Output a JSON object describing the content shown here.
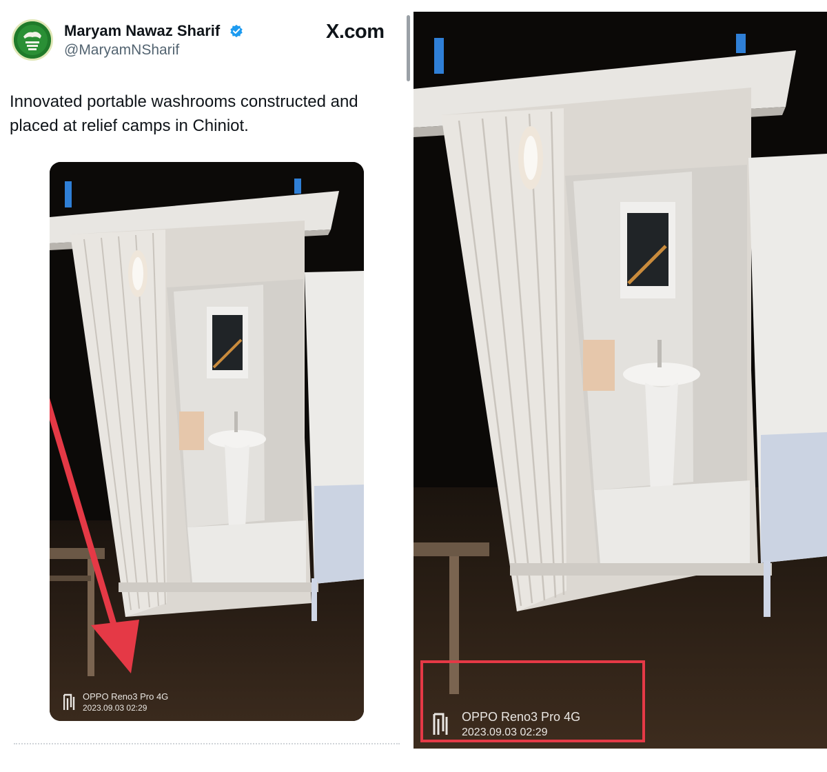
{
  "tweet": {
    "display_name": "Maryam Nawaz Sharif",
    "handle": "@MaryamNSharif",
    "verified_icon": "verified-badge-icon",
    "site_label": "X.com",
    "text": "Innovated portable washrooms constructed and placed at relief camps in Chiniot."
  },
  "photo": {
    "subject": "portable washroom at night",
    "watermark_model": "OPPO Reno3 Pro 4G",
    "watermark_datetime": "2023.09.03 02:29"
  },
  "annotations": {
    "arrow_icon": "red-arrow-icon",
    "highlight_color": "#e53946"
  },
  "colors": {
    "verified_blue": "#1d9bf0",
    "text_primary": "#0f1419",
    "text_secondary": "#536471",
    "annotation_red": "#e53946"
  }
}
